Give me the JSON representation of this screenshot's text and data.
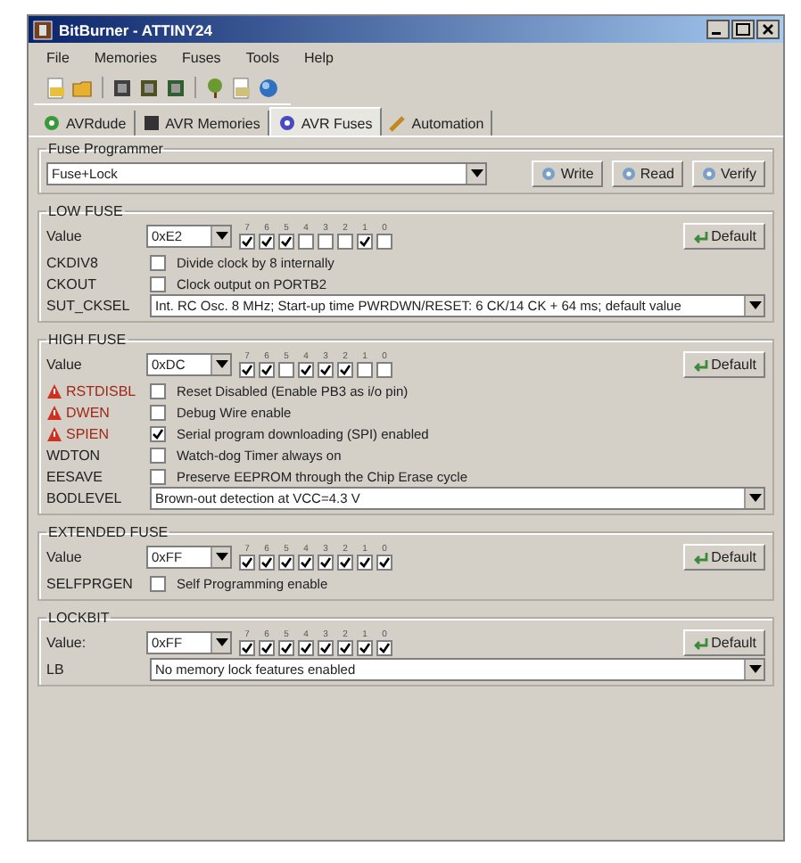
{
  "window": {
    "title": "BitBurner - ATTINY24"
  },
  "menu": [
    "File",
    "Memories",
    "Fuses",
    "Tools",
    "Help"
  ],
  "tabs": [
    {
      "label": "AVRdude",
      "selected": false
    },
    {
      "label": "AVR Memories",
      "selected": false
    },
    {
      "label": "AVR Fuses",
      "selected": true
    },
    {
      "label": "Automation",
      "selected": false
    }
  ],
  "fuse_programmer": {
    "title": "Fuse Programmer",
    "selection": "Fuse+Lock",
    "buttons": [
      "Write",
      "Read",
      "Verify"
    ]
  },
  "sections": [
    {
      "title": "LOW FUSE",
      "value_label": "Value",
      "value": "0xE2",
      "default_button": "Default",
      "bits": [
        {
          "label": "7",
          "checked": true
        },
        {
          "label": "6",
          "checked": true
        },
        {
          "label": "5",
          "checked": true
        },
        {
          "label": "4",
          "checked": false
        },
        {
          "label": "3",
          "checked": false
        },
        {
          "label": "2",
          "checked": false
        },
        {
          "label": "1",
          "checked": true
        },
        {
          "label": "0",
          "checked": false
        }
      ],
      "rows": [
        {
          "kind": "checkbox",
          "name": "CKDIV8",
          "warning": false,
          "checked": false,
          "text": "Divide clock by 8 internally"
        },
        {
          "kind": "checkbox",
          "name": "CKOUT",
          "warning": false,
          "checked": false,
          "text": "Clock output on PORTB2"
        },
        {
          "kind": "select",
          "name": "SUT_CKSEL",
          "text": "Int. RC Osc. 8 MHz; Start-up time PWRDWN/RESET: 6 CK/14 CK + 64 ms; default value"
        }
      ]
    },
    {
      "title": "HIGH FUSE",
      "value_label": "Value",
      "value": "0xDC",
      "default_button": "Default",
      "bits": [
        {
          "label": "7",
          "checked": true
        },
        {
          "label": "6",
          "checked": true
        },
        {
          "label": "5",
          "checked": false
        },
        {
          "label": "4",
          "checked": true
        },
        {
          "label": "3",
          "checked": true
        },
        {
          "label": "2",
          "checked": true
        },
        {
          "label": "1",
          "checked": false
        },
        {
          "label": "0",
          "checked": false
        }
      ],
      "rows": [
        {
          "kind": "checkbox",
          "name": "RSTDISBL",
          "warning": true,
          "checked": false,
          "text": "Reset Disabled (Enable PB3 as i/o pin)"
        },
        {
          "kind": "checkbox",
          "name": "DWEN",
          "warning": true,
          "checked": false,
          "text": "Debug Wire enable"
        },
        {
          "kind": "checkbox",
          "name": "SPIEN",
          "warning": true,
          "checked": true,
          "text": "Serial program downloading (SPI) enabled"
        },
        {
          "kind": "checkbox",
          "name": "WDTON",
          "warning": false,
          "checked": false,
          "text": "Watch-dog Timer always on"
        },
        {
          "kind": "checkbox",
          "name": "EESAVE",
          "warning": false,
          "checked": false,
          "text": "Preserve EEPROM through the Chip Erase cycle"
        },
        {
          "kind": "select",
          "name": "BODLEVEL",
          "text": "Brown-out detection at VCC=4.3 V"
        }
      ]
    },
    {
      "title": "EXTENDED FUSE",
      "value_label": "Value",
      "value": "0xFF",
      "default_button": "Default",
      "bits": [
        {
          "label": "7",
          "checked": true
        },
        {
          "label": "6",
          "checked": true
        },
        {
          "label": "5",
          "checked": true
        },
        {
          "label": "4",
          "checked": true
        },
        {
          "label": "3",
          "checked": true
        },
        {
          "label": "2",
          "checked": true
        },
        {
          "label": "1",
          "checked": true
        },
        {
          "label": "0",
          "checked": true
        }
      ],
      "rows": [
        {
          "kind": "checkbox",
          "name": "SELFPRGEN",
          "warning": false,
          "checked": false,
          "text": "Self Programming enable"
        }
      ]
    },
    {
      "title": "LOCKBIT",
      "value_label": "Value:",
      "value": "0xFF",
      "default_button": "Default",
      "bits": [
        {
          "label": "7",
          "checked": true
        },
        {
          "label": "6",
          "checked": true
        },
        {
          "label": "5",
          "checked": true
        },
        {
          "label": "4",
          "checked": true
        },
        {
          "label": "3",
          "checked": true
        },
        {
          "label": "2",
          "checked": true
        },
        {
          "label": "1",
          "checked": true
        },
        {
          "label": "0",
          "checked": true
        }
      ],
      "rows": [
        {
          "kind": "select",
          "name": "LB",
          "text": "No memory lock features enabled"
        }
      ]
    }
  ]
}
